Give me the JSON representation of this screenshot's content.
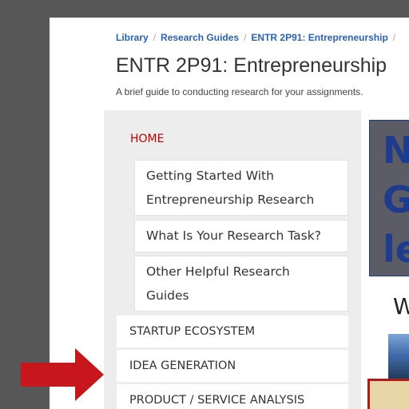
{
  "breadcrumb": {
    "items": [
      "Library",
      "Research Guides",
      "ENTR 2P91: Entrepreneurship"
    ],
    "separator": "/"
  },
  "page": {
    "title": "ENTR 2P91: Entrepreneurship",
    "subtitle": "A brief guide to conducting research for your assignments."
  },
  "sidebar": {
    "home": "HOME",
    "subitems": [
      "Getting Started With Entrepreneurship Research",
      "What Is Your Research Task?",
      "Other Helpful Research Guides"
    ],
    "items": [
      "STARTUP ECOSYSTEM",
      "IDEA GENERATION",
      "PRODUCT / SERVICE ANALYSIS"
    ]
  },
  "content": {
    "banner_text": "N\nG\nle",
    "heading_fragment": "W"
  },
  "colors": {
    "accent_red": "#c00000",
    "link_blue": "#2a62b8",
    "arrow_red": "#c8161d"
  }
}
